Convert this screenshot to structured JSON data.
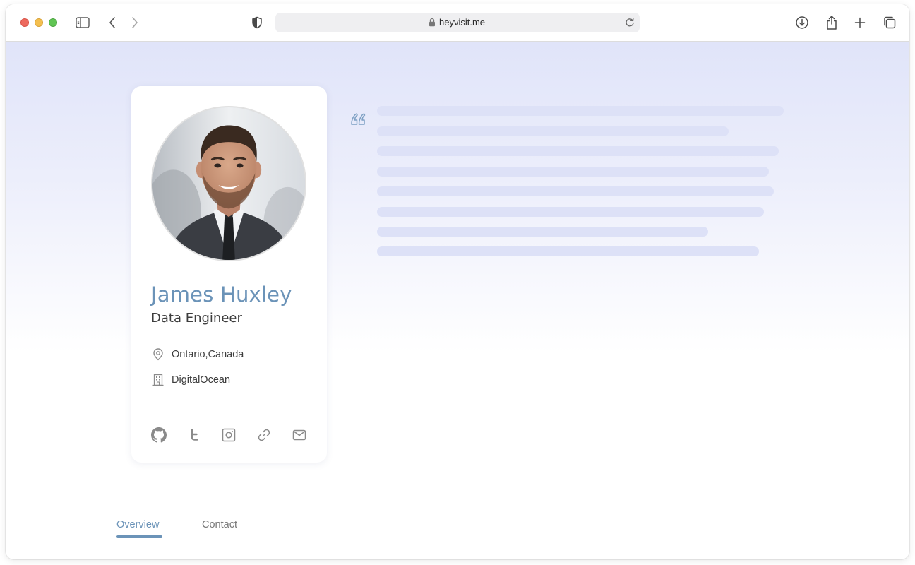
{
  "browser": {
    "url": "heyvisit.me"
  },
  "profile": {
    "name": "James Huxley",
    "role": "Data Engineer",
    "location": "Ontario,Canada",
    "company": "DigitalOcean"
  },
  "tabs": [
    {
      "label": "Overview",
      "active": true
    },
    {
      "label": "Contact",
      "active": false
    }
  ],
  "colors": {
    "accent": "#6b93b8",
    "skeleton": "#dde1f7",
    "background_top": "#e0e4f9"
  },
  "icons": {
    "socials": [
      "github-icon",
      "twitter-icon",
      "instagram-icon",
      "link-icon",
      "mail-icon"
    ]
  }
}
